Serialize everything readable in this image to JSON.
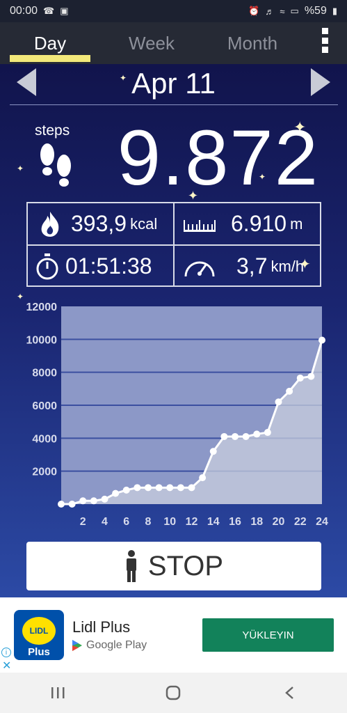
{
  "status_bar": {
    "time": "00:00",
    "battery": "%59"
  },
  "tabs": [
    {
      "label": "Day"
    },
    {
      "label": "Week"
    },
    {
      "label": "Month"
    }
  ],
  "date": "Apr 11",
  "steps": {
    "label": "steps",
    "value": "9.872"
  },
  "stats": {
    "calories": {
      "value": "393,9",
      "unit": "kcal"
    },
    "distance": {
      "value": "6.910",
      "unit": "m"
    },
    "duration": {
      "value": "01:51:38",
      "unit": ""
    },
    "speed": {
      "value": "3,7",
      "unit": "km/h"
    }
  },
  "chart_data": {
    "type": "area",
    "x_ticks": [
      2,
      4,
      6,
      8,
      10,
      12,
      14,
      16,
      18,
      20,
      22,
      24
    ],
    "y_ticks": [
      2000,
      4000,
      6000,
      8000,
      10000,
      12000
    ],
    "ylim": [
      0,
      12000
    ],
    "xlim": [
      0,
      24
    ],
    "series": [
      {
        "x": [
          0,
          1,
          2,
          3,
          4,
          5,
          6,
          7,
          8,
          9,
          10,
          11,
          12,
          13,
          14,
          15,
          16,
          17,
          18,
          19,
          20,
          21,
          22,
          23,
          24
        ],
        "y": [
          0,
          0,
          200,
          200,
          300,
          650,
          850,
          1000,
          1000,
          1000,
          1000,
          1000,
          1000,
          1600,
          3200,
          4100,
          4100,
          4100,
          4250,
          4350,
          6200,
          6850,
          7650,
          7750,
          9950
        ]
      }
    ],
    "colors": {
      "line": "#ffffff",
      "fill": "#c8cdde",
      "bg": "#8c98c7"
    }
  },
  "stop_button": {
    "label": "STOP"
  },
  "ad": {
    "title": "Lidl Plus",
    "store": "Google Play",
    "cta": "YÜKLEYIN",
    "logo_top": "LIDL",
    "logo_bottom": "Plus"
  }
}
